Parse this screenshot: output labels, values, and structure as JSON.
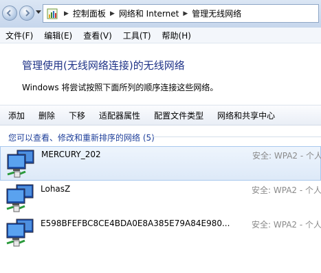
{
  "breadcrumb": [
    "控制面板",
    "网络和 Internet",
    "管理无线网络"
  ],
  "menu": [
    "文件(F)",
    "编辑(E)",
    "查看(V)",
    "工具(T)",
    "帮助(H)"
  ],
  "header": {
    "title": "管理使用(无线网络连接)的无线网络",
    "description": "Windows 将尝试按照下面所列的顺序连接这些网络。"
  },
  "toolbar": [
    "添加",
    "删除",
    "下移",
    "适配器属性",
    "配置文件类型",
    "网络和共享中心"
  ],
  "list": {
    "header": "您可以查看、修改和重新排序的网络 (5)",
    "networks": [
      {
        "ssid": "MERCURY_202",
        "security": "安全: WPA2 - 个人"
      },
      {
        "ssid": "LohasZ",
        "security": "安全: WPA2 - 个人"
      },
      {
        "ssid": "E598BFEFBC8CE4BDA0E8A385E79A84E980...",
        "security": "安全: WPA2 - 个人"
      }
    ]
  },
  "colors": {
    "title": "#1e3287",
    "list_header": "#1e3f9a",
    "security": "#8a8a8a",
    "selection": "#dde9f8"
  }
}
